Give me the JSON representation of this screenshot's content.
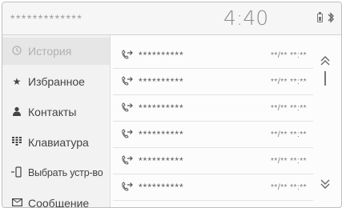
{
  "header": {
    "device_name": "*************",
    "time": "4:40",
    "battery_icon": "battery-icon",
    "bluetooth_icon": "bluetooth-icon"
  },
  "sidebar": {
    "items": [
      {
        "icon": "clock-icon",
        "label": "История",
        "active": true
      },
      {
        "icon": "star-icon",
        "label": "Избранное",
        "active": false
      },
      {
        "icon": "person-icon",
        "label": "Контакты",
        "active": false
      },
      {
        "icon": "keypad-icon",
        "label": "Клавиатура",
        "active": false
      },
      {
        "icon": "device-icon",
        "label": "Выбрать устр-во",
        "active": false
      },
      {
        "icon": "message-icon",
        "label": "Сообщение",
        "active": false
      }
    ]
  },
  "history": {
    "rows": [
      {
        "name": "**********",
        "time": "**/** **:**",
        "icon": "outgoing-call-icon"
      },
      {
        "name": "**********",
        "time": "**/** **:**",
        "icon": "outgoing-call-icon"
      },
      {
        "name": "**********",
        "time": "**/** **:**",
        "icon": "outgoing-call-icon"
      },
      {
        "name": "**********",
        "time": "**/** **:**",
        "icon": "outgoing-call-icon"
      },
      {
        "name": "**********",
        "time": "**/** **:**",
        "icon": "outgoing-call-icon"
      },
      {
        "name": "**********",
        "time": "**/** **:**",
        "icon": "outgoing-call-icon"
      }
    ]
  },
  "scroll": {
    "up_icon": "scroll-up-icon",
    "down_icon": "scroll-down-icon"
  }
}
